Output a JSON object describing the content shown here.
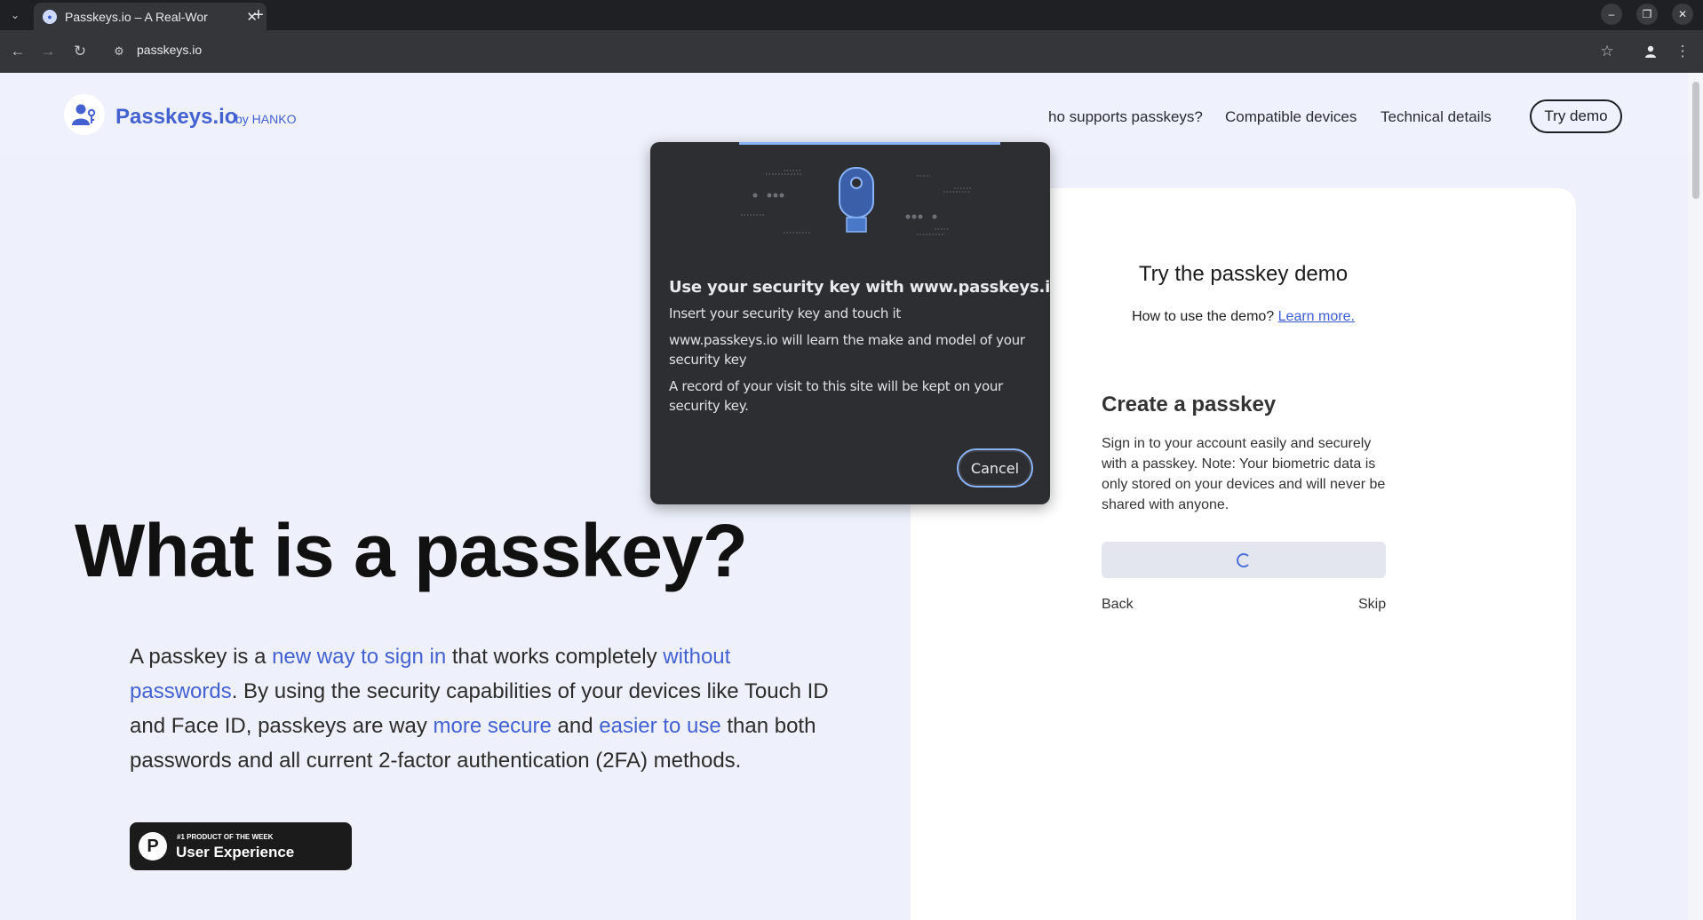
{
  "browser": {
    "tab_title": "Passkeys.io – A Real-Wor",
    "url": "passkeys.io",
    "tab_favicon": "passkeys-favicon"
  },
  "header": {
    "logo_name": "Passkeys.io",
    "logo_by": "by HANKO",
    "nav": [
      "ho supports passkeys?",
      "Compatible devices",
      "Technical details"
    ],
    "cta": "Try demo"
  },
  "hero": {
    "title": "What is a passkey?",
    "text_parts": [
      {
        "t": "A passkey is a ",
        "hl": false
      },
      {
        "t": "new way to sign in",
        "hl": true
      },
      {
        "t": " that works completely ",
        "hl": false
      },
      {
        "t": "without passwords",
        "hl": true
      },
      {
        "t": ". By using the security capabilities of your devices like Touch ID and Face ID, passkeys are way ",
        "hl": false
      },
      {
        "t": "more secure",
        "hl": true
      },
      {
        "t": " and ",
        "hl": false
      },
      {
        "t": "easier to use",
        "hl": true
      },
      {
        "t": " than both passwords and all current 2-factor authentication (2FA) methods.",
        "hl": false
      }
    ],
    "badge_small": "#1 PRODUCT OF THE WEEK",
    "badge_big": "User Experience",
    "badge_logo": "P"
  },
  "demo": {
    "title": "Try the passkey demo",
    "howto": "How to use the demo?",
    "learn_more": "Learn more.",
    "create_title": "Create a passkey",
    "create_desc": "Sign in to your account easily and securely with a passkey. Note: Your biometric data is only stored on your devices and will never be shared with anyone.",
    "back": "Back",
    "skip": "Skip"
  },
  "dialog": {
    "title": "Use your security key with www.passkeys.io",
    "line1": "Insert your security key and touch it",
    "line2": "www.passkeys.io will learn the make and model of your security key",
    "line3": "A record of your visit to this site will be kept on your security key.",
    "cancel": "Cancel",
    "illustration": "security-key-illustration"
  },
  "colors": {
    "accent": "#4461d1",
    "dialog_bg": "#2d2e31",
    "dialog_focus": "#8ab4f8",
    "page_bg": "#eef1fb"
  }
}
